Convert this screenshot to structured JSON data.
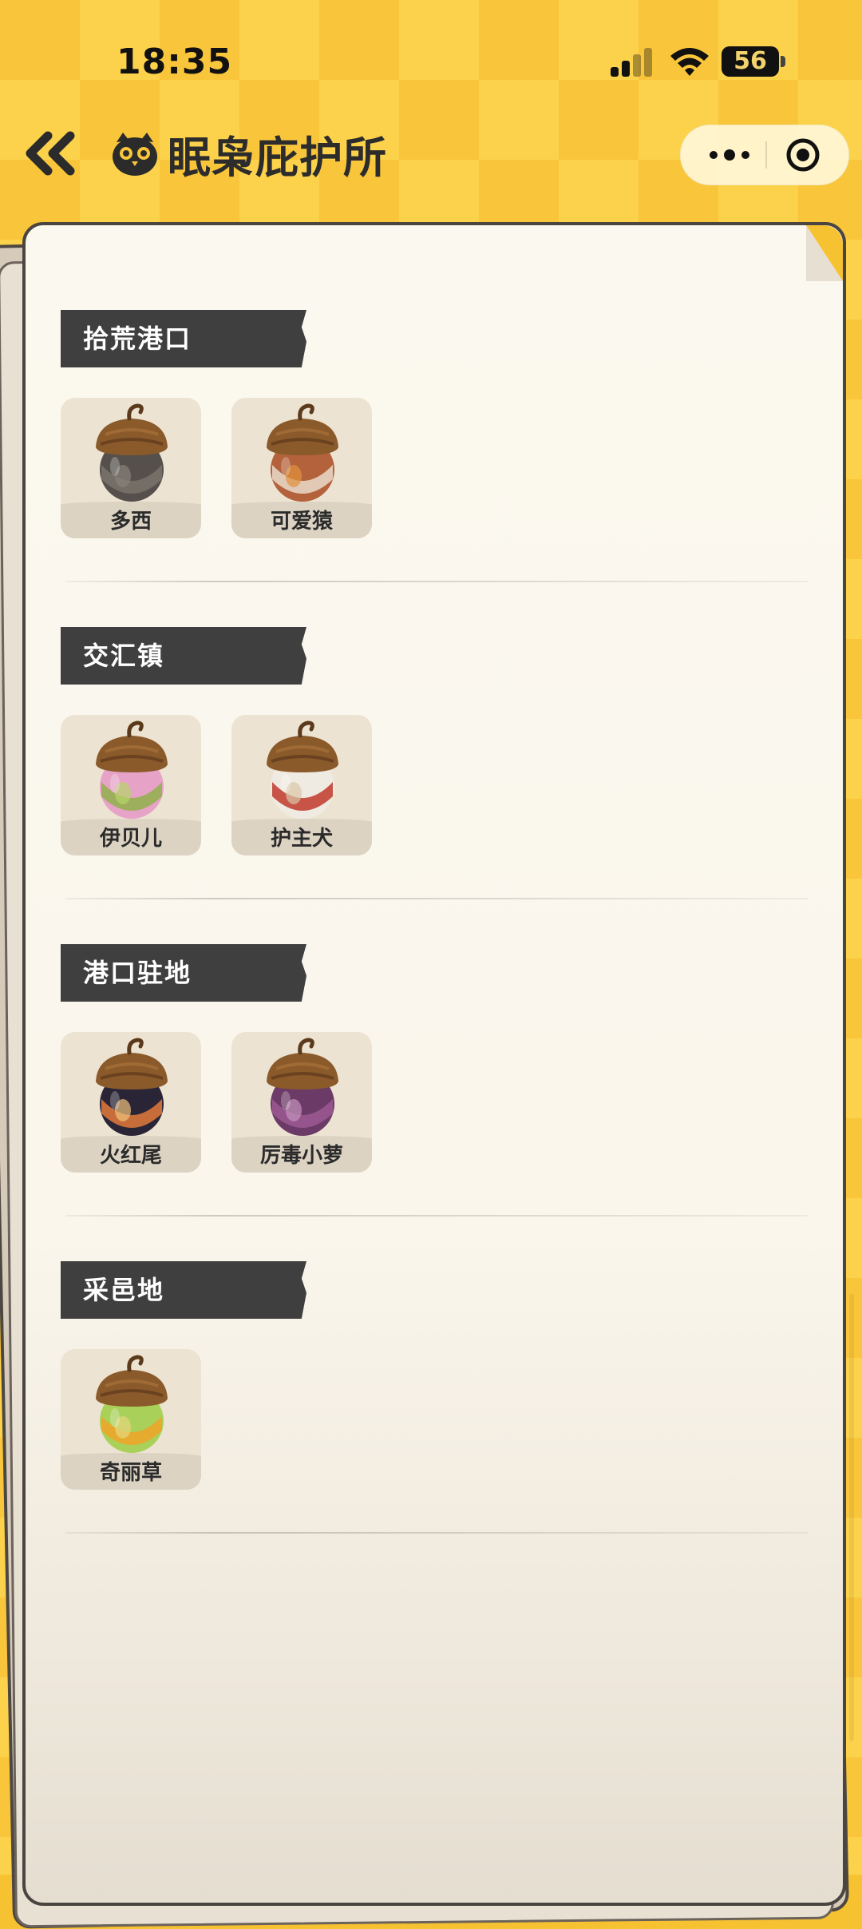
{
  "status_bar": {
    "time": "18:35",
    "battery": "56"
  },
  "header": {
    "title": "眠枭庇护所"
  },
  "sections": [
    {
      "title": "拾荒港口",
      "items": [
        {
          "name": "多西",
          "colors": {
            "body": "#55504c",
            "band": "#7b736c",
            "accent": "#8a827a"
          }
        },
        {
          "name": "可爱猿",
          "colors": {
            "body": "#b4623b",
            "band": "#eadccb",
            "accent": "#e0913d"
          }
        }
      ]
    },
    {
      "title": "交汇镇",
      "items": [
        {
          "name": "伊贝儿",
          "colors": {
            "body": "#e7a3c7",
            "band": "#8fb04a",
            "accent": "#b7d469"
          }
        },
        {
          "name": "护主犬",
          "colors": {
            "body": "#f0ebe2",
            "band": "#c1392d",
            "accent": "#d9c6a6"
          }
        }
      ]
    },
    {
      "title": "港口驻地",
      "items": [
        {
          "name": "火红尾",
          "colors": {
            "body": "#2a2437",
            "band": "#e27a3a",
            "accent": "#f1c27a"
          }
        },
        {
          "name": "厉毒小萝",
          "colors": {
            "body": "#6b3a66",
            "band": "#9c5a93",
            "accent": "#c494bd"
          }
        }
      ]
    },
    {
      "title": "采邑地",
      "items": [
        {
          "name": "奇丽草",
          "colors": {
            "body": "#a9d15a",
            "band": "#f0a327",
            "accent": "#e7d77c"
          }
        }
      ]
    }
  ]
}
